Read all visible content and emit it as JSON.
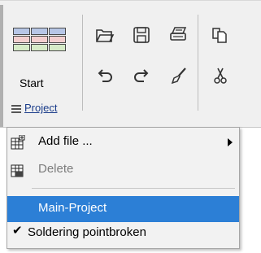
{
  "ribbon": {
    "start_label": "Start",
    "project_label": "Project",
    "icons": {
      "open": "folder-open-icon",
      "save": "save-disk-icon",
      "print": "printer-icon",
      "copy": "copy-icon",
      "undo": "undo-icon",
      "redo": "redo-icon",
      "brush": "brush-icon",
      "cut": "scissors-icon"
    }
  },
  "menu": {
    "items": [
      {
        "label": "Add file ...",
        "icon": "add-file-grid-icon",
        "has_submenu": true,
        "enabled": true
      },
      {
        "label": "Delete",
        "icon": "delete-grid-icon",
        "enabled": false
      },
      {
        "label": "Main-Project",
        "selected": true
      },
      {
        "label": "Soldering pointbroken",
        "checked": true
      }
    ]
  },
  "colors": {
    "selection": "#2c7fd6",
    "link": "#1a3c8a"
  }
}
